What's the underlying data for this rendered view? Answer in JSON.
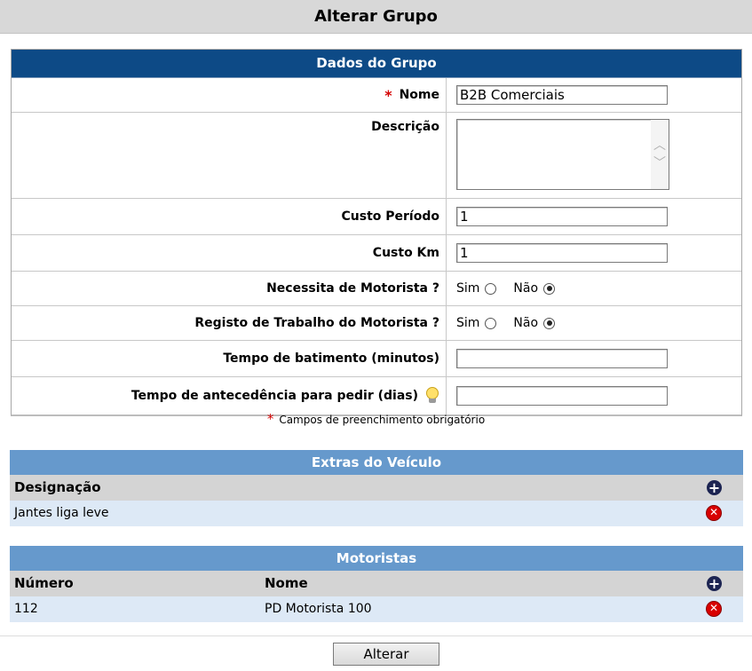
{
  "page": {
    "title": "Alterar Grupo"
  },
  "form": {
    "title": "Dados do Grupo",
    "required_mark": "*",
    "fields": {
      "nome": {
        "label": "Nome",
        "value": "B2B Comerciais"
      },
      "descricao": {
        "label": "Descrição",
        "value": ""
      },
      "custo_periodo": {
        "label": "Custo Período",
        "value": "1"
      },
      "custo_km": {
        "label": "Custo Km",
        "value": "1"
      },
      "necessita_motorista": {
        "label": "Necessita de Motorista ?",
        "option_yes": "Sim",
        "option_no": "Não",
        "selected": "Não"
      },
      "registo_trabalho": {
        "label": "Registo de Trabalho do Motorista ?",
        "option_yes": "Sim",
        "option_no": "Não",
        "selected": "Não"
      },
      "tempo_batimento": {
        "label": "Tempo de batimento (minutos)",
        "value": ""
      },
      "tempo_antecedencia": {
        "label": "Tempo de antecedência para pedir (dias)",
        "value": "",
        "icon": "lightbulb-icon"
      }
    },
    "required_note": "Campos de preenchimento obrigatório"
  },
  "extras": {
    "title": "Extras do Veículo",
    "columns": [
      "Designação"
    ],
    "rows": [
      {
        "designacao": "Jantes liga leve"
      }
    ]
  },
  "motoristas": {
    "title": "Motoristas",
    "columns": [
      "Número",
      "Nome"
    ],
    "rows": [
      {
        "numero": "112",
        "nome": "PD Motorista 100"
      }
    ]
  },
  "actions": {
    "submit_label": "Alterar"
  },
  "colors": {
    "form_header": "#0d4a86",
    "section_header": "#6699cc",
    "row_highlight": "#dde9f6",
    "required": "#d40000",
    "delete": "#d80000",
    "add": "#1c2452"
  }
}
